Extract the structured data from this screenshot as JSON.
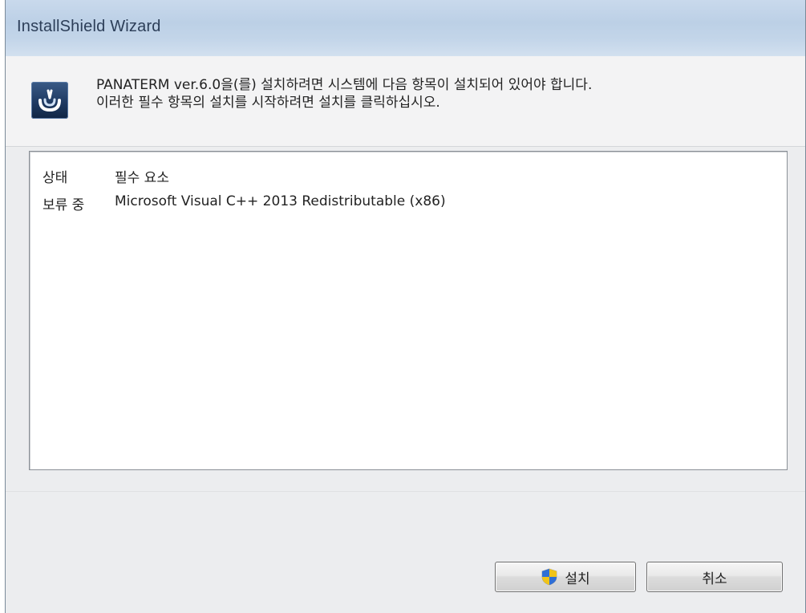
{
  "window": {
    "title": "InstallShield Wizard"
  },
  "header": {
    "icon": "installshield-icon",
    "line1": "PANATERM ver.6.0을(를) 설치하려면 시스템에 다음 항목이 설치되어 있어야 합니다.",
    "line2": "이러한 필수 항목의 설치를 시작하려면 설치를 클릭하십시오."
  },
  "list": {
    "columns": {
      "status": "상태",
      "requirement": "필수 요소"
    },
    "rows": [
      {
        "status": "보류 중",
        "requirement": "Microsoft Visual C++ 2013 Redistributable (x86)"
      }
    ]
  },
  "buttons": {
    "install": {
      "label": "설치",
      "icon": "uac-shield-icon"
    },
    "cancel": {
      "label": "취소"
    }
  }
}
